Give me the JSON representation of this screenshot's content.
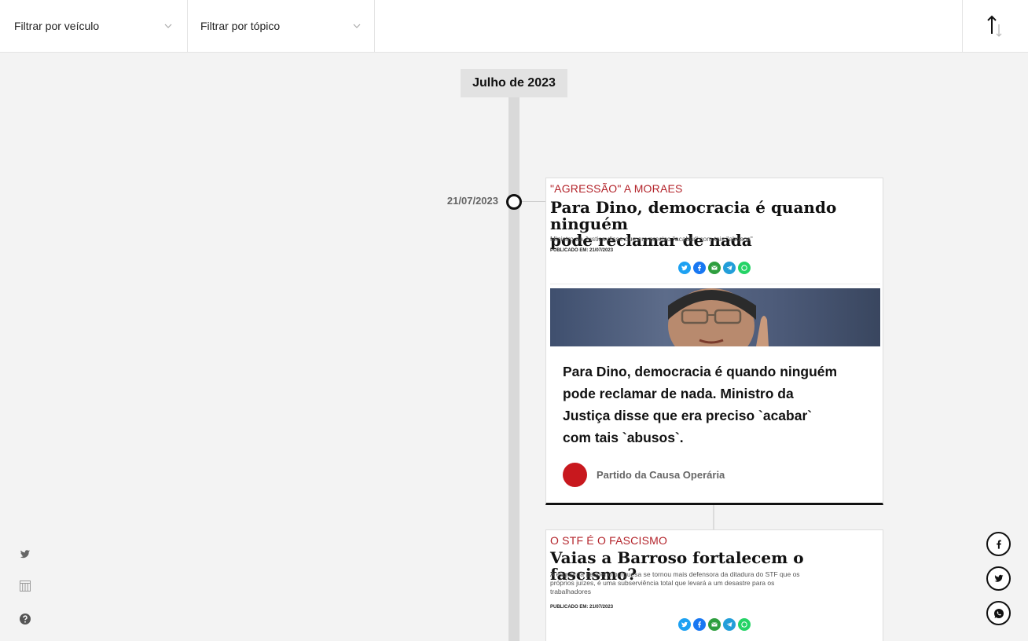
{
  "filters": {
    "vehicle_label": "Filtrar por veículo",
    "topic_label": "Filtrar por tópico"
  },
  "sort": {
    "icon": "sort-arrows-icon"
  },
  "timeline": {
    "month": "Julho de 2023",
    "entries": [
      {
        "date": "21/07/2023",
        "kicker": "\"AGRESSÃO\" A MORAES",
        "headline_line1": "Para Dino, democracia é quando ninguém",
        "headline_line2": "pode reclamar de nada",
        "dek": "Ministro da Justiça disse que era preciso \"acabar\" com tais \"abusos\"",
        "published": "PUBLICADO EM: 21/07/2023",
        "excerpt_line1": "Para Dino, democracia é quando ninguém",
        "excerpt_line2": "pode reclamar de nada. Ministro da",
        "excerpt_line3": "Justiça disse que era preciso `acabar`",
        "excerpt_line4": "com tais `abusos`.",
        "source": "Partido da Causa Operária",
        "source_color": "#c8181e"
      },
      {
        "kicker": "O STF É O FASCISMO",
        "headline_line1": "Vaias a Barroso fortalecem o fascismo?",
        "dek_line1": "A esquerda pequeno burguesa se tornou mais defensora da ditadura do STF que os",
        "dek_line2": "próprios juízes, é uma subserviência total que levará a um desastre para os",
        "dek_line3": "trabalhadores",
        "published": "PUBLICADO EM: 21/07/2023"
      }
    ]
  },
  "share_icons": [
    "twitter-icon",
    "facebook-icon",
    "email-icon",
    "telegram-icon",
    "whatsapp-icon"
  ],
  "colors": {
    "accent_red": "#b3232a",
    "twitter": "#1da1f2",
    "facebook": "#1877f2",
    "email": "#2e9e3e",
    "telegram": "#229ed9",
    "whatsapp": "#25d366"
  }
}
